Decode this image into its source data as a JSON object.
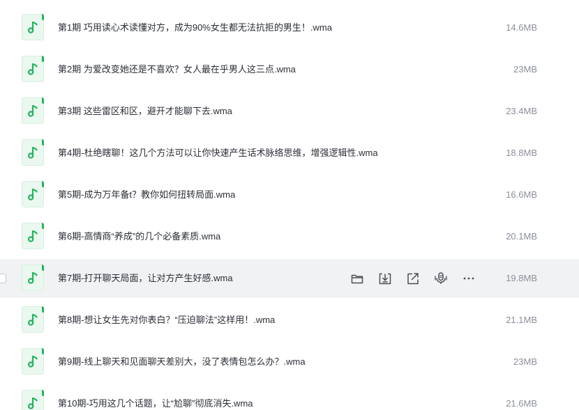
{
  "colors": {
    "row_hover_bg": "#f1f2f4",
    "icon_bg": "#eaf8ef",
    "icon_accent": "#22b35e",
    "name_text": "#2b2f36",
    "size_text": "#8a8f99"
  },
  "file_icon": "music-note-icon",
  "row_actions": [
    {
      "name": "folder-icon"
    },
    {
      "name": "download-icon"
    },
    {
      "name": "share-icon"
    },
    {
      "name": "transcribe-icon"
    },
    {
      "name": "more-icon"
    }
  ],
  "files": [
    {
      "name": "第1期 巧用读心术读懂对方，成为90%女生都无法抗拒的男生！.wma",
      "size": "14.6MB"
    },
    {
      "name": "第2期 为爱改变她还是不喜欢？女人最在乎男人这三点.wma",
      "size": "23MB"
    },
    {
      "name": "第3期 这些雷区和区，避开才能聊下去.wma",
      "size": "23.4MB"
    },
    {
      "name": "第4期-杜绝瞎聊！这几个方法可以让你快速产生话术脉络思维，增强逻辑性.wma",
      "size": "18.8MB"
    },
    {
      "name": "第5期-成为万年备t？教你如何扭转局面.wma",
      "size": "16.6MB"
    },
    {
      "name": "第6期-高情商“养成”的几个必备素质.wma",
      "size": "20.1MB"
    },
    {
      "name": "第7期-打开聊天局面，让对方产生好感.wma",
      "size": "19.8MB",
      "hovered": true
    },
    {
      "name": "第8期-想让女生先对你表白？“压迫聊法”这样用！.wma",
      "size": "21.1MB"
    },
    {
      "name": "第9期-线上聊天和见面聊天差别大，没了表情包怎么办？.wma",
      "size": "23MB"
    },
    {
      "name": "第10期-巧用这几个话题，让“尬聊”彻底消失.wma",
      "size": "21.6MB"
    }
  ]
}
